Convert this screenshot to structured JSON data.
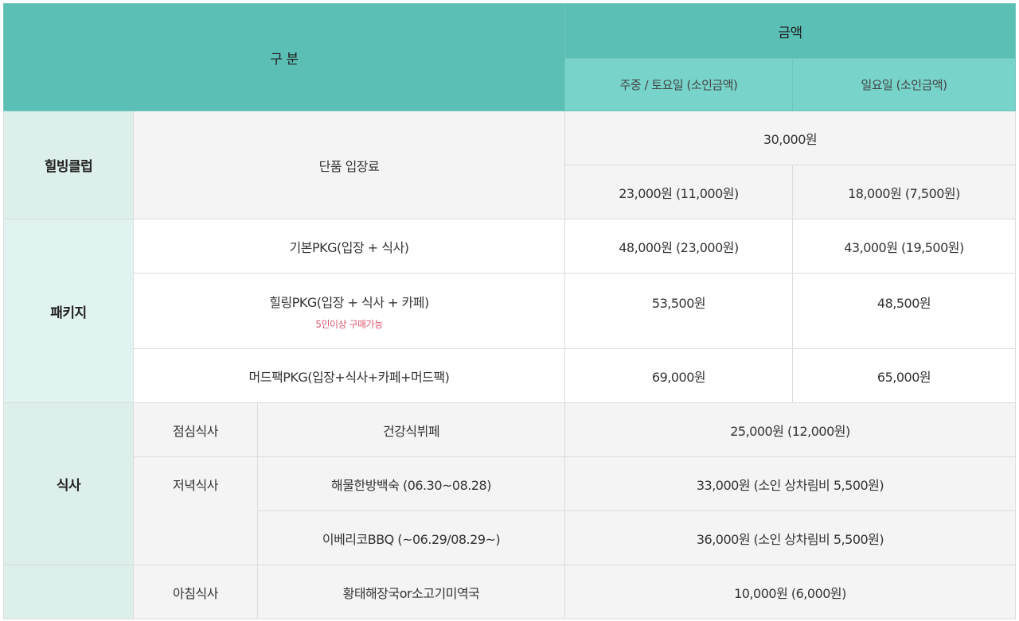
{
  "header": {
    "category": "구 분",
    "amount": "금액",
    "weekday": "주중 / 토요일 (소인금액)",
    "sunday": "일요일 (소인금액)"
  },
  "healing_club": {
    "label": "힐빙클럽",
    "item": "단품 입장료",
    "common_price": "30,000원",
    "weekday_price": "23,000원 (11,000원)",
    "sunday_price": "18,000원 (7,500원)"
  },
  "package": {
    "label": "패키지",
    "rows": [
      {
        "name": "기본PKG(입장 + 식사)",
        "note": "",
        "weekday": "48,000원 (23,000원)",
        "sunday": "43,000원 (19,500원)"
      },
      {
        "name": "힐링PKG(입장 + 식사 + 카페)",
        "note": "5인이상 구매가능",
        "weekday": "53,500원",
        "sunday": "48,500원"
      },
      {
        "name": "머드팩PKG(입장+식사+카페+머드팩)",
        "note": "",
        "weekday": "69,000원",
        "sunday": "65,000원"
      }
    ]
  },
  "meal": {
    "label": "식사",
    "lunch": {
      "type": "점심식사",
      "menu": "건강식뷔페",
      "price": "25,000원 (12,000원)"
    },
    "dinner": {
      "type": "저녁식사",
      "menu": "해물한방백숙 (06.30~08.28)",
      "price": "33,000원 (소인 상차림비 5,500원)"
    },
    "bbq": {
      "menu": "이베리코BBQ (~06.29/08.29~)",
      "price": "36,000원 (소인 상차림비 5,500원)"
    },
    "breakfast": {
      "type": "아침식사",
      "menu": "황태해장국or소고기미역국",
      "price": "10,000원 (6,000원)"
    }
  }
}
